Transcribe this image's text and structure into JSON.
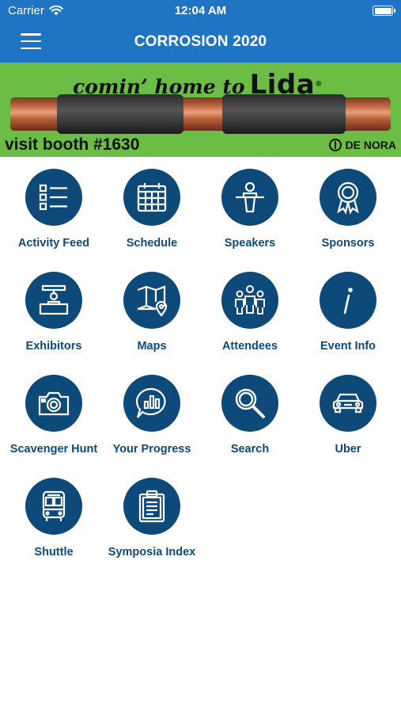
{
  "status_bar": {
    "carrier": "Carrier",
    "time": "12:04 AM"
  },
  "nav": {
    "title": "CORROSION 2020"
  },
  "banner": {
    "tagline": "comin’ home to",
    "brand": "Lida",
    "registered": "®",
    "booth": "visit booth #1630",
    "sponsor": "DE NORA"
  },
  "tiles": [
    {
      "label": "Activity Feed",
      "icon": "list-icon"
    },
    {
      "label": "Schedule",
      "icon": "calendar-icon"
    },
    {
      "label": "Speakers",
      "icon": "podium-icon"
    },
    {
      "label": "Sponsors",
      "icon": "award-ribbon-icon"
    },
    {
      "label": "Exhibitors",
      "icon": "booth-icon"
    },
    {
      "label": "Maps",
      "icon": "map-icon"
    },
    {
      "label": "Attendees",
      "icon": "people-icon"
    },
    {
      "label": "Event Info",
      "icon": "info-icon"
    },
    {
      "label": "Scavenger Hunt",
      "icon": "camera-icon"
    },
    {
      "label": "Your Progress",
      "icon": "chat-chart-icon"
    },
    {
      "label": "Search",
      "icon": "magnifier-icon"
    },
    {
      "label": "Uber",
      "icon": "car-icon"
    },
    {
      "label": "Shuttle",
      "icon": "bus-icon"
    },
    {
      "label": "Symposia Index",
      "icon": "clipboard-icon"
    }
  ],
  "colors": {
    "header": "#1f75c4",
    "banner": "#6cbd45",
    "icon_circle": "#0d4a7a",
    "label": "#0d4a7a"
  }
}
